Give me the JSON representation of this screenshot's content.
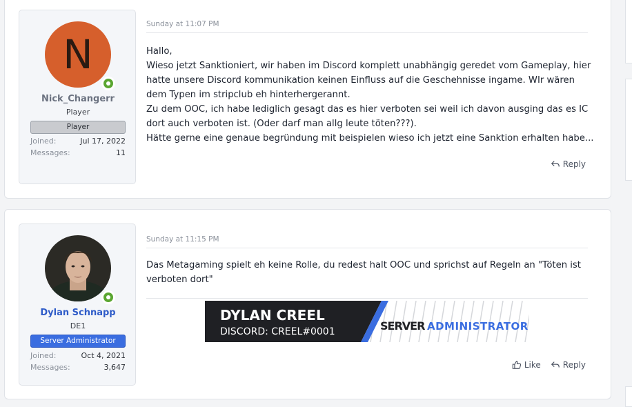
{
  "posts": [
    {
      "user": {
        "avatar_letter": "N",
        "username": "Nick_Changerr",
        "title": "Player",
        "banner": "Player",
        "joined_label": "Joined:",
        "joined_value": "Jul 17, 2022",
        "messages_label": "Messages:",
        "messages_value": "11"
      },
      "timestamp": "Sunday at 11:07 PM",
      "lines": [
        "Hallo,",
        "Wieso jetzt Sanktioniert, wir haben im Discord komplett unabhängig geredet vom Gameplay, hier",
        "hatte unsere Discord kommunikation keinen Einfluss auf die Geschehnisse ingame. WIr wären",
        "dem Typen im stripclub eh hinterhergerannt.",
        "Zu dem OOC, ich habe lediglich gesagt das es hier verboten sei weil ich davon ausging das es IC",
        "dort auch verboten ist. (Oder darf man allg leute töten???).",
        "Hätte gerne eine genaue begründung mit beispielen wieso ich jetzt eine Sanktion erhalten habe..."
      ],
      "reply_label": "Reply"
    },
    {
      "user": {
        "username": "Dylan Schnapp",
        "title": "DE1",
        "banner": "Server Administrator",
        "joined_label": "Joined:",
        "joined_value": "Oct 4, 2021",
        "messages_label": "Messages:",
        "messages_value": "3,647"
      },
      "timestamp": "Sunday at 11:15 PM",
      "lines": [
        "Das Metagaming spielt eh keine Rolle, du redest halt OOC und sprichst auf Regeln an \"Töten ist",
        "verboten dort\""
      ],
      "signature": {
        "name": "DYLAN CREEL",
        "discord": "DISCORD: CREEL#0001",
        "role_server": "SERVER",
        "role_admin": "ADMINISTRATOR"
      },
      "like_label": "Like",
      "reply_label": "Reply"
    }
  ],
  "colors": {
    "online": "#5aa631",
    "admin_banner": "#3a6de0",
    "admin_name": "#2f5cc8",
    "avatar_bg": "#d65f2c"
  }
}
